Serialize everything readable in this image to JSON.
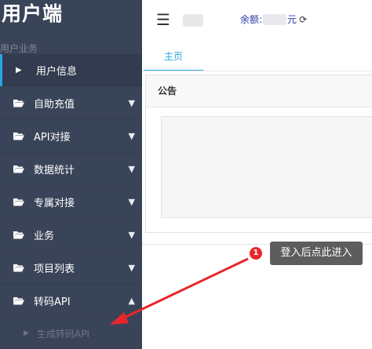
{
  "app": {
    "title": "用户端"
  },
  "sidebar": {
    "section_title": "用户业务",
    "items": [
      {
        "label": "用户信息",
        "icon": "caret-right-icon",
        "active": true
      },
      {
        "label": "自助充值",
        "icon": "folder-open-icon"
      },
      {
        "label": "API对接",
        "icon": "folder-open-icon"
      },
      {
        "label": "数据统计",
        "icon": "folder-open-icon"
      },
      {
        "label": "专属对接",
        "icon": "folder-open-icon"
      },
      {
        "label": "业务",
        "icon": "folder-open-icon"
      },
      {
        "label": "项目列表",
        "icon": "folder-open-icon"
      },
      {
        "label": "转码API",
        "icon": "folder-open-icon",
        "expanded": true
      }
    ],
    "submenu": {
      "label": "生成转码API"
    }
  },
  "header": {
    "menu_icon": "hamburger-icon",
    "balance_prefix": "余额:",
    "balance_suffix": "元",
    "refresh_icon": "refresh-icon"
  },
  "tabs": [
    {
      "label": "主页",
      "active": true
    }
  ],
  "panel": {
    "title": "公告",
    "body": ""
  },
  "annotation": {
    "number": "1",
    "text": "登入后点此进入",
    "color": "#e8262c"
  },
  "colors": {
    "sidebar_bg": "#3a4459",
    "accent": "#2aa7e0",
    "link": "#2b3aa8"
  }
}
